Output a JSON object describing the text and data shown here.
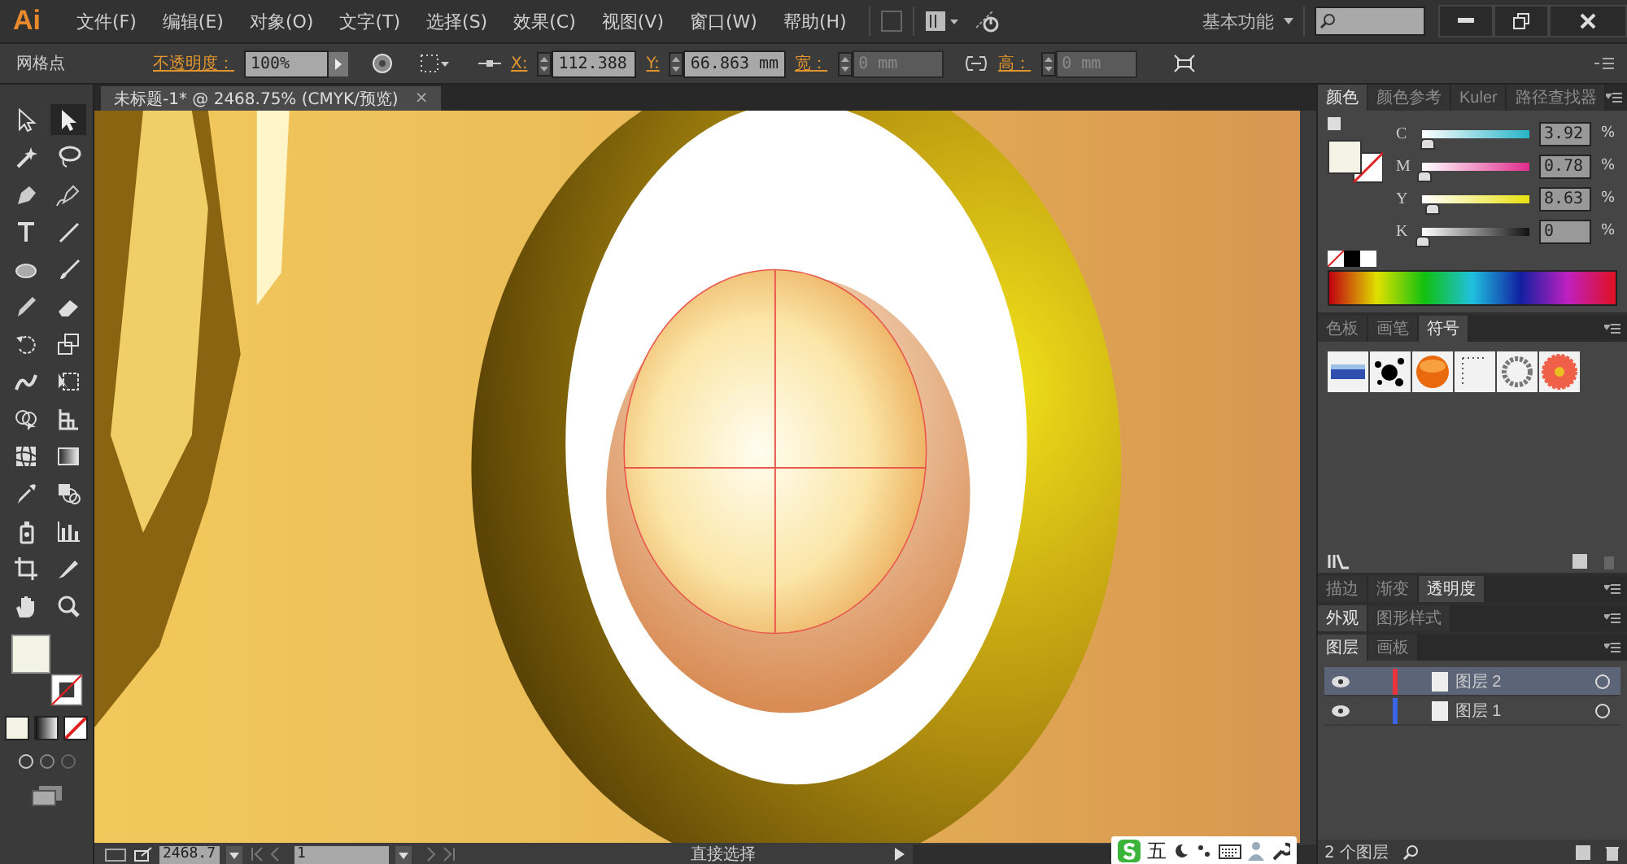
{
  "app": {
    "logo": "Ai"
  },
  "menu": [
    "文件(F)",
    "编辑(E)",
    "对象(O)",
    "文字(T)",
    "选择(S)",
    "效果(C)",
    "视图(V)",
    "窗口(W)",
    "帮助(H)"
  ],
  "workspace": {
    "label": "基本功能"
  },
  "control_bar": {
    "selection_label": "网格点",
    "opacity_label": "不透明度：",
    "opacity_value": "100%",
    "x_label": "X:",
    "x_value": "112.388",
    "y_label": "Y:",
    "y_value": "66.863 mm",
    "w_label": "宽：",
    "w_value": "0 mm",
    "h_label": "高：",
    "h_value": "0 mm"
  },
  "document_tab": {
    "title": "未标题-1* @ 2468.75% (CMYK/预览)",
    "close": "×"
  },
  "tools": [
    {
      "kind": "select",
      "selected": false
    },
    {
      "kind": "direct",
      "selected": true
    },
    {
      "kind": "wand",
      "selected": false
    },
    {
      "kind": "lasso",
      "selected": false
    },
    {
      "kind": "pen",
      "selected": false
    },
    {
      "kind": "pen2",
      "selected": false
    },
    {
      "kind": "type",
      "selected": false
    },
    {
      "kind": "line",
      "selected": false
    },
    {
      "kind": "ellipse",
      "selected": false
    },
    {
      "kind": "brush",
      "selected": false
    },
    {
      "kind": "pencil",
      "selected": false
    },
    {
      "kind": "eraser",
      "selected": false
    },
    {
      "kind": "rotate",
      "selected": false
    },
    {
      "kind": "scale",
      "selected": false
    },
    {
      "kind": "warp",
      "selected": false
    },
    {
      "kind": "transform",
      "selected": false
    },
    {
      "kind": "builder",
      "selected": false
    },
    {
      "kind": "perspective",
      "selected": false
    },
    {
      "kind": "mesh",
      "selected": false
    },
    {
      "kind": "gradient",
      "selected": false
    },
    {
      "kind": "eyedropper",
      "selected": false
    },
    {
      "kind": "blend",
      "selected": false
    },
    {
      "kind": "spray",
      "selected": false
    },
    {
      "kind": "graph",
      "selected": false
    },
    {
      "kind": "artboard",
      "selected": false
    },
    {
      "kind": "slice",
      "selected": false
    },
    {
      "kind": "hand",
      "selected": false
    },
    {
      "kind": "zoom",
      "selected": false
    }
  ],
  "color_panel": {
    "tabs": [
      {
        "label": "颜色",
        "selected": true
      },
      {
        "label": "颜色参考",
        "selected": false
      },
      {
        "label": "Kuler",
        "selected": false
      },
      {
        "label": "路径查找器",
        "selected": false
      }
    ],
    "channels": [
      {
        "name": "C",
        "level": 0.0392,
        "value": "3.92",
        "unit": "%"
      },
      {
        "name": "M",
        "level": 0.0078,
        "value": "0.78",
        "unit": "%"
      },
      {
        "name": "Y",
        "level": 0.0863,
        "value": "8.63",
        "unit": "%"
      },
      {
        "name": "K",
        "level": 0,
        "value": "0",
        "unit": "%"
      }
    ]
  },
  "symbols_panel": {
    "tabs": [
      {
        "label": "色板",
        "selected": false
      },
      {
        "label": "画笔",
        "selected": false
      },
      {
        "label": "符号",
        "selected": true
      }
    ]
  },
  "stroke_panel": {
    "tabs": [
      {
        "label": "描边",
        "selected": false
      },
      {
        "label": "渐变",
        "selected": false
      },
      {
        "label": "透明度",
        "selected": true
      }
    ]
  },
  "appearance_panel": {
    "tabs": [
      {
        "label": "外观",
        "selected": true
      },
      {
        "label": "图形样式",
        "selected": false
      }
    ]
  },
  "layers_panel": {
    "tabs": [
      {
        "label": "图层",
        "selected": true
      },
      {
        "label": "画板",
        "selected": false
      }
    ],
    "layers": [
      {
        "name": "图层 2",
        "selected": true,
        "color": "#e8343c"
      },
      {
        "name": "图层 1",
        "selected": false,
        "color": "#3c64e6"
      }
    ],
    "count": "2 个图层"
  },
  "status_bar": {
    "zoom": "2468.7",
    "page": "1",
    "tool": "直接选择"
  },
  "ime": {
    "label": "五"
  }
}
